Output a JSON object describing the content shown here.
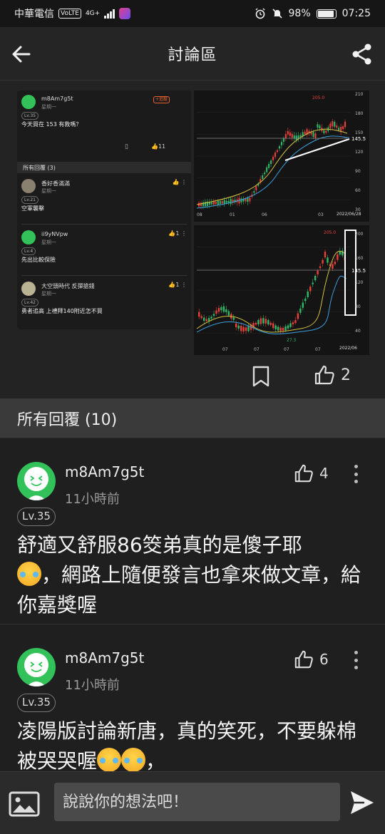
{
  "status_bar": {
    "carrier": "中華電信",
    "volte": "VoLTE",
    "network": "4G+",
    "battery": "98%",
    "time": "07:25"
  },
  "app_bar": {
    "title": "討論區"
  },
  "post_preview": {
    "question": {
      "user": "m8Am7g5t",
      "time": "星期一",
      "level": "Lv.35",
      "text": "今天買在 153 有救嗎？",
      "likes": "11",
      "track_label": "+追蹤"
    },
    "replies_header": "所有回覆 (3)",
    "replies": [
      {
        "user": "香好香滿滿",
        "time": "星期一",
        "level": "Lv.21",
        "text": "空軍襲擊",
        "likes": ""
      },
      {
        "user": "ii9yNVpw",
        "time": "星期一",
        "level": "Lv.4",
        "text": "先出比較保險",
        "likes": "1"
      },
      {
        "user": "大空頭時代 反彈搶錢",
        "time": "星期一",
        "level": "Lv.42",
        "text": "勇者追高 上禮拜140附近怎不買",
        "likes": "1"
      }
    ],
    "chart_top": {
      "peak_label": "205.0",
      "price_label": "145.5",
      "date_label": "2022/06/28",
      "y_ticks": [
        "210",
        "180",
        "150",
        "120",
        "90",
        "60",
        "30"
      ],
      "x_ticks": [
        "08",
        "01",
        "06",
        "03"
      ]
    },
    "chart_bottom": {
      "peak_label": "205.0",
      "price_label": "145.5",
      "low_label": "27.3",
      "date_label": "2022/06",
      "y_ticks": [
        "200",
        "160",
        "120",
        "80",
        "40"
      ],
      "x_ticks": [
        "07",
        "07",
        "07",
        "07"
      ]
    }
  },
  "post_actions": {
    "like_count": "2"
  },
  "comments_section": {
    "header": "所有回覆 (10)"
  },
  "comments": [
    {
      "user": "m8Am7g5t",
      "time": "11小時前",
      "level": "Lv.35",
      "likes": "4",
      "text_a": "舒適又舒服86筊弟真的是傻子耶",
      "text_b": "，網路上隨便發言也拿來做文章，給你嘉獎喔"
    },
    {
      "user": "m8Am7g5t",
      "time": "11小時前",
      "level": "Lv.35",
      "likes": "6",
      "text_a": "凌陽版討論新唐，真的笑死，不要躲棉被哭哭喔",
      "text_b": "，"
    }
  ],
  "composer": {
    "placeholder": "說說你的想法吧！"
  },
  "colors": {
    "accent_green": "#33c25a",
    "candle_up": "#e8403b",
    "candle_down": "#2fb86a"
  }
}
